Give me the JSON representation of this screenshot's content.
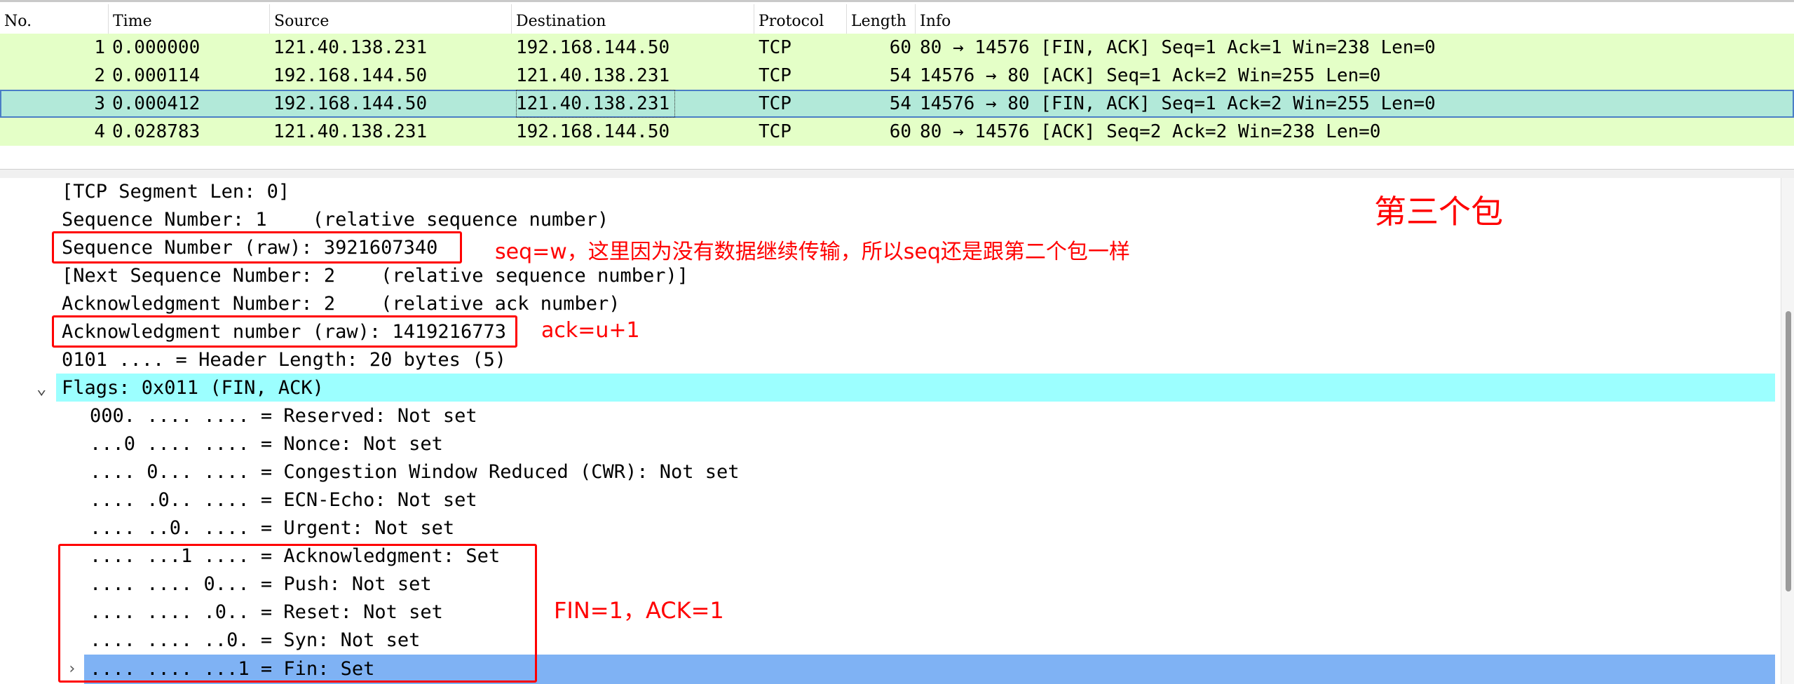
{
  "packet_list": {
    "columns": [
      "No.",
      "Time",
      "Source",
      "Destination",
      "Protocol",
      "Length",
      "Info"
    ],
    "rows": [
      {
        "no": "1",
        "time": "0.000000",
        "src": "121.40.138.231",
        "dst": "192.168.144.50",
        "proto": "TCP",
        "len": "60",
        "info": "80 → 14576 [FIN, ACK] Seq=1 Ack=1 Win=238 Len=0"
      },
      {
        "no": "2",
        "time": "0.000114",
        "src": "192.168.144.50",
        "dst": "121.40.138.231",
        "proto": "TCP",
        "len": "54",
        "info": "14576 → 80 [ACK] Seq=1 Ack=2 Win=255 Len=0"
      },
      {
        "no": "3",
        "time": "0.000412",
        "src": "192.168.144.50",
        "dst": "121.40.138.231",
        "proto": "TCP",
        "len": "54",
        "info": "14576 → 80 [FIN, ACK] Seq=1 Ack=2 Win=255 Len=0"
      },
      {
        "no": "4",
        "time": "0.028783",
        "src": "121.40.138.231",
        "dst": "192.168.144.50",
        "proto": "TCP",
        "len": "60",
        "info": "80 → 14576 [ACK] Seq=2 Ack=2 Win=238 Len=0"
      }
    ],
    "selected_row": 3,
    "colors": {
      "row_bg": "#e4ffc7",
      "selected_bg": "#b2e9d9",
      "selected_outline": "#4a7ec6"
    }
  },
  "details": {
    "lines": [
      "[TCP Segment Len: 0]",
      "Sequence Number: 1    (relative sequence number)",
      "Sequence Number (raw): 3921607340",
      "[Next Sequence Number: 2    (relative sequence number)]",
      "Acknowledgment Number: 2    (relative ack number)",
      "Acknowledgment number (raw): 1419216773",
      "0101 .... = Header Length: 20 bytes (5)",
      "Flags: 0x011 (FIN, ACK)",
      "000. .... .... = Reserved: Not set",
      "...0 .... .... = Nonce: Not set",
      ".... 0... .... = Congestion Window Reduced (CWR): Not set",
      ".... .0.. .... = ECN-Echo: Not set",
      ".... ..0. .... = Urgent: Not set",
      ".... ...1 .... = Acknowledgment: Set",
      ".... .... 0... = Push: Not set",
      ".... .... .0.. = Reset: Not set",
      ".... .... ..0. = Syn: Not set",
      ".... .... ...1 = Fin: Set"
    ],
    "expander_open": "⌄",
    "expander_closed": "›",
    "colors": {
      "flags_bg": "#9cffff",
      "fin_bg": "#7fb2f4"
    }
  },
  "annotations": {
    "title": "第三个包",
    "seq_note": "seq=w，这里因为没有数据继续传输，所以seq还是跟第二个包一样",
    "ack_note": "ack=u+1",
    "flags_note": "FIN=1，ACK=1",
    "color": "#ff0000"
  }
}
